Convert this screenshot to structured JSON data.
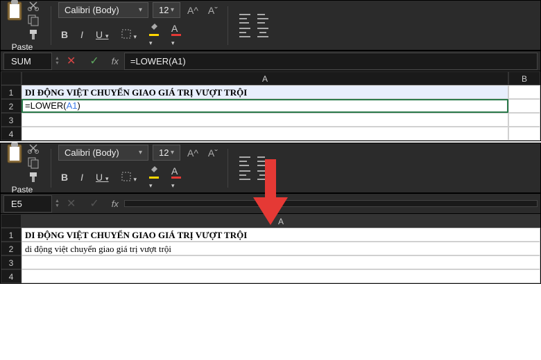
{
  "top": {
    "ribbon": {
      "paste_label": "Paste",
      "font_name": "Calibri (Body)",
      "font_size": "12"
    },
    "formula_bar": {
      "name_box": "SUM",
      "fx": "fx",
      "formula": "=LOWER(A1)"
    },
    "grid": {
      "col_A": "A",
      "col_B": "B",
      "rows": [
        "1",
        "2",
        "3",
        "4"
      ],
      "a1": "DI ĐỘNG VIỆT CHUYỂN GIAO GIÁ TRỊ VƯỢT TRỘI",
      "a2_prefix": "=LOWER(",
      "a2_ref": "A1",
      "a2_suffix": ")"
    }
  },
  "bottom": {
    "ribbon": {
      "paste_label": "Paste",
      "font_name": "Calibri (Body)",
      "font_size": "12"
    },
    "formula_bar": {
      "name_box": "E5",
      "fx": "fx",
      "formula": ""
    },
    "grid": {
      "col_A": "A",
      "rows": [
        "1",
        "2",
        "3",
        "4"
      ],
      "a1": "DI ĐỘNG VIỆT CHUYỂN GIAO GIÁ TRỊ VƯỢT TRỘI",
      "a2": "di động việt chuyển giao giá trị vượt trội"
    }
  }
}
